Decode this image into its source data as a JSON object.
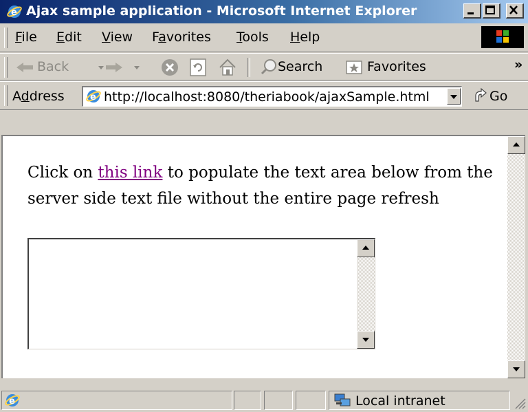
{
  "window": {
    "title": "Ajax sample application - Microsoft Internet Explorer",
    "minimize": "minimize",
    "maximize": "maximize",
    "close": "close"
  },
  "menu": {
    "items": [
      {
        "pre": "",
        "key": "F",
        "post": "ile"
      },
      {
        "pre": "",
        "key": "E",
        "post": "dit"
      },
      {
        "pre": "",
        "key": "V",
        "post": "iew"
      },
      {
        "pre": "F",
        "key": "a",
        "post": "vorites"
      },
      {
        "pre": "",
        "key": "T",
        "post": "ools"
      },
      {
        "pre": "",
        "key": "H",
        "post": "elp"
      }
    ]
  },
  "toolbar": {
    "back": "Back",
    "search": "Search",
    "favorites": "Favorites",
    "more": "»"
  },
  "address": {
    "label_pre": "A",
    "label_key": "d",
    "label_post": "dress",
    "url": "http://localhost:8080/theriabook/ajaxSample.html",
    "go": "Go"
  },
  "page": {
    "text_before": "Click on ",
    "link": "this link",
    "text_after": " to populate the text area below from the server side text file without the entire page refresh",
    "textarea_value": ""
  },
  "status": {
    "zone": "Local intranet"
  },
  "colors": {
    "title_gradient_start": "#0a246a",
    "title_gradient_end": "#a6caf0",
    "visited_link": "#800080",
    "chrome": "#d4d0c8"
  }
}
